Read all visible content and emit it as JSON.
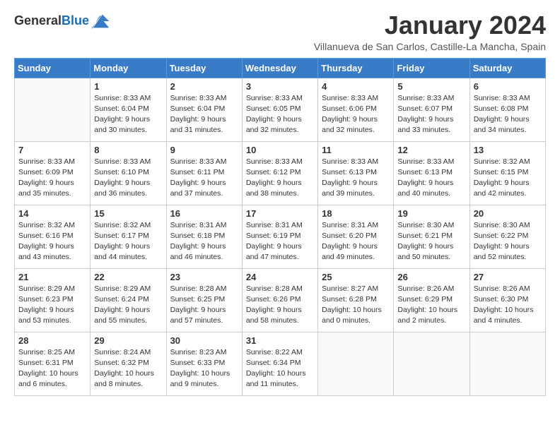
{
  "header": {
    "logo_general": "General",
    "logo_blue": "Blue",
    "month_title": "January 2024",
    "subtitle": "Villanueva de San Carlos, Castille-La Mancha, Spain"
  },
  "weekdays": [
    "Sunday",
    "Monday",
    "Tuesday",
    "Wednesday",
    "Thursday",
    "Friday",
    "Saturday"
  ],
  "weeks": [
    [
      {
        "day": "",
        "sunrise": "",
        "sunset": "",
        "daylight": ""
      },
      {
        "day": "1",
        "sunrise": "Sunrise: 8:33 AM",
        "sunset": "Sunset: 6:04 PM",
        "daylight": "Daylight: 9 hours and 30 minutes."
      },
      {
        "day": "2",
        "sunrise": "Sunrise: 8:33 AM",
        "sunset": "Sunset: 6:04 PM",
        "daylight": "Daylight: 9 hours and 31 minutes."
      },
      {
        "day": "3",
        "sunrise": "Sunrise: 8:33 AM",
        "sunset": "Sunset: 6:05 PM",
        "daylight": "Daylight: 9 hours and 32 minutes."
      },
      {
        "day": "4",
        "sunrise": "Sunrise: 8:33 AM",
        "sunset": "Sunset: 6:06 PM",
        "daylight": "Daylight: 9 hours and 32 minutes."
      },
      {
        "day": "5",
        "sunrise": "Sunrise: 8:33 AM",
        "sunset": "Sunset: 6:07 PM",
        "daylight": "Daylight: 9 hours and 33 minutes."
      },
      {
        "day": "6",
        "sunrise": "Sunrise: 8:33 AM",
        "sunset": "Sunset: 6:08 PM",
        "daylight": "Daylight: 9 hours and 34 minutes."
      }
    ],
    [
      {
        "day": "7",
        "sunrise": "Sunrise: 8:33 AM",
        "sunset": "Sunset: 6:09 PM",
        "daylight": "Daylight: 9 hours and 35 minutes."
      },
      {
        "day": "8",
        "sunrise": "Sunrise: 8:33 AM",
        "sunset": "Sunset: 6:10 PM",
        "daylight": "Daylight: 9 hours and 36 minutes."
      },
      {
        "day": "9",
        "sunrise": "Sunrise: 8:33 AM",
        "sunset": "Sunset: 6:11 PM",
        "daylight": "Daylight: 9 hours and 37 minutes."
      },
      {
        "day": "10",
        "sunrise": "Sunrise: 8:33 AM",
        "sunset": "Sunset: 6:12 PM",
        "daylight": "Daylight: 9 hours and 38 minutes."
      },
      {
        "day": "11",
        "sunrise": "Sunrise: 8:33 AM",
        "sunset": "Sunset: 6:13 PM",
        "daylight": "Daylight: 9 hours and 39 minutes."
      },
      {
        "day": "12",
        "sunrise": "Sunrise: 8:33 AM",
        "sunset": "Sunset: 6:13 PM",
        "daylight": "Daylight: 9 hours and 40 minutes."
      },
      {
        "day": "13",
        "sunrise": "Sunrise: 8:32 AM",
        "sunset": "Sunset: 6:15 PM",
        "daylight": "Daylight: 9 hours and 42 minutes."
      }
    ],
    [
      {
        "day": "14",
        "sunrise": "Sunrise: 8:32 AM",
        "sunset": "Sunset: 6:16 PM",
        "daylight": "Daylight: 9 hours and 43 minutes."
      },
      {
        "day": "15",
        "sunrise": "Sunrise: 8:32 AM",
        "sunset": "Sunset: 6:17 PM",
        "daylight": "Daylight: 9 hours and 44 minutes."
      },
      {
        "day": "16",
        "sunrise": "Sunrise: 8:31 AM",
        "sunset": "Sunset: 6:18 PM",
        "daylight": "Daylight: 9 hours and 46 minutes."
      },
      {
        "day": "17",
        "sunrise": "Sunrise: 8:31 AM",
        "sunset": "Sunset: 6:19 PM",
        "daylight": "Daylight: 9 hours and 47 minutes."
      },
      {
        "day": "18",
        "sunrise": "Sunrise: 8:31 AM",
        "sunset": "Sunset: 6:20 PM",
        "daylight": "Daylight: 9 hours and 49 minutes."
      },
      {
        "day": "19",
        "sunrise": "Sunrise: 8:30 AM",
        "sunset": "Sunset: 6:21 PM",
        "daylight": "Daylight: 9 hours and 50 minutes."
      },
      {
        "day": "20",
        "sunrise": "Sunrise: 8:30 AM",
        "sunset": "Sunset: 6:22 PM",
        "daylight": "Daylight: 9 hours and 52 minutes."
      }
    ],
    [
      {
        "day": "21",
        "sunrise": "Sunrise: 8:29 AM",
        "sunset": "Sunset: 6:23 PM",
        "daylight": "Daylight: 9 hours and 53 minutes."
      },
      {
        "day": "22",
        "sunrise": "Sunrise: 8:29 AM",
        "sunset": "Sunset: 6:24 PM",
        "daylight": "Daylight: 9 hours and 55 minutes."
      },
      {
        "day": "23",
        "sunrise": "Sunrise: 8:28 AM",
        "sunset": "Sunset: 6:25 PM",
        "daylight": "Daylight: 9 hours and 57 minutes."
      },
      {
        "day": "24",
        "sunrise": "Sunrise: 8:28 AM",
        "sunset": "Sunset: 6:26 PM",
        "daylight": "Daylight: 9 hours and 58 minutes."
      },
      {
        "day": "25",
        "sunrise": "Sunrise: 8:27 AM",
        "sunset": "Sunset: 6:28 PM",
        "daylight": "Daylight: 10 hours and 0 minutes."
      },
      {
        "day": "26",
        "sunrise": "Sunrise: 8:26 AM",
        "sunset": "Sunset: 6:29 PM",
        "daylight": "Daylight: 10 hours and 2 minutes."
      },
      {
        "day": "27",
        "sunrise": "Sunrise: 8:26 AM",
        "sunset": "Sunset: 6:30 PM",
        "daylight": "Daylight: 10 hours and 4 minutes."
      }
    ],
    [
      {
        "day": "28",
        "sunrise": "Sunrise: 8:25 AM",
        "sunset": "Sunset: 6:31 PM",
        "daylight": "Daylight: 10 hours and 6 minutes."
      },
      {
        "day": "29",
        "sunrise": "Sunrise: 8:24 AM",
        "sunset": "Sunset: 6:32 PM",
        "daylight": "Daylight: 10 hours and 8 minutes."
      },
      {
        "day": "30",
        "sunrise": "Sunrise: 8:23 AM",
        "sunset": "Sunset: 6:33 PM",
        "daylight": "Daylight: 10 hours and 9 minutes."
      },
      {
        "day": "31",
        "sunrise": "Sunrise: 8:22 AM",
        "sunset": "Sunset: 6:34 PM",
        "daylight": "Daylight: 10 hours and 11 minutes."
      },
      {
        "day": "",
        "sunrise": "",
        "sunset": "",
        "daylight": ""
      },
      {
        "day": "",
        "sunrise": "",
        "sunset": "",
        "daylight": ""
      },
      {
        "day": "",
        "sunrise": "",
        "sunset": "",
        "daylight": ""
      }
    ]
  ]
}
